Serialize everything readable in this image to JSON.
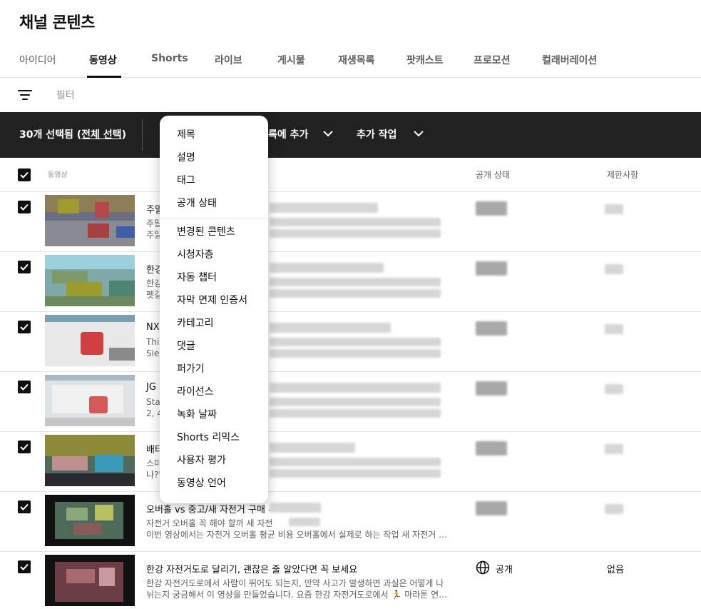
{
  "page": {
    "title": "채널 콘텐츠"
  },
  "tabs": [
    {
      "label": "아이디어"
    },
    {
      "label": "동영상"
    },
    {
      "label": "Shorts"
    },
    {
      "label": "라이브"
    },
    {
      "label": "게시물"
    },
    {
      "label": "재생목록"
    },
    {
      "label": "팟캐스트"
    },
    {
      "label": "프로모션"
    },
    {
      "label": "컬래버레이션"
    }
  ],
  "filter": {
    "label": "필터",
    "icon": "filter-icon"
  },
  "selection": {
    "count_text": "30개 선택됨 (",
    "select_all": "전체 선택",
    "close_paren": ")",
    "add_to_playlist": "록에 추가",
    "more_actions": "추가 작업"
  },
  "table": {
    "headers": {
      "video": "동영상",
      "visibility": "공개 상태",
      "restrictions": "제한사항"
    }
  },
  "rows": [
    {
      "title": "주말",
      "desc1": "주말",
      "desc2": "주말"
    },
    {
      "title": "한강",
      "desc1": "한강",
      "desc2": "펫길"
    },
    {
      "title": "NX",
      "desc1": "This",
      "desc2": "Sier"
    },
    {
      "title": "JG",
      "desc1": "Star",
      "desc2": "2, 4,"
    },
    {
      "title": "배터",
      "desc1": "스마",
      "desc2": "나?\""
    },
    {
      "title": "오버홀 vs 중고/새 자전거 구매 – ",
      "desc1": "자전거 오버홀 꼭 해야 할까 새 자전",
      "desc2": "이번 영상에서는 자전거 오버홀 평균 비용 오버홀에서 실제로 하는 작업 새 자전거 …"
    },
    {
      "title": "한강 자전거도로 달리기, 괜찮은 줄 알았다면 꼭 보세요",
      "desc1": "한강 자전거도로에서 사람이 뛰어도 되는지, 만약 사고가 발생하면 과실은 어떻게 나",
      "desc2": "뉘는지 궁금해서 이 영상을 만들었습니다. 요즘 한강 자전거도로에서 🏃 마라톤 연…",
      "visibility": "공개",
      "restrictions": "없음"
    }
  ],
  "menu": {
    "items": [
      {
        "label": "제목"
      },
      {
        "label": "설명"
      },
      {
        "label": "태그"
      },
      {
        "label": "공개 상태"
      },
      {
        "label": "변경된 콘텐츠"
      },
      {
        "label": "시청자층"
      },
      {
        "label": "자동 챕터"
      },
      {
        "label": "자막 면제 인증서"
      },
      {
        "label": "카테고리"
      },
      {
        "label": "댓글"
      },
      {
        "label": "퍼가기"
      },
      {
        "label": "라이선스"
      },
      {
        "label": "녹화 날짜"
      },
      {
        "label": "Shorts 리믹스"
      },
      {
        "label": "사용자 평가"
      },
      {
        "label": "동영상 언어"
      }
    ]
  },
  "colors": {
    "selection_bar": "#212121",
    "text": "#0f0f0f",
    "muted": "#606060"
  }
}
